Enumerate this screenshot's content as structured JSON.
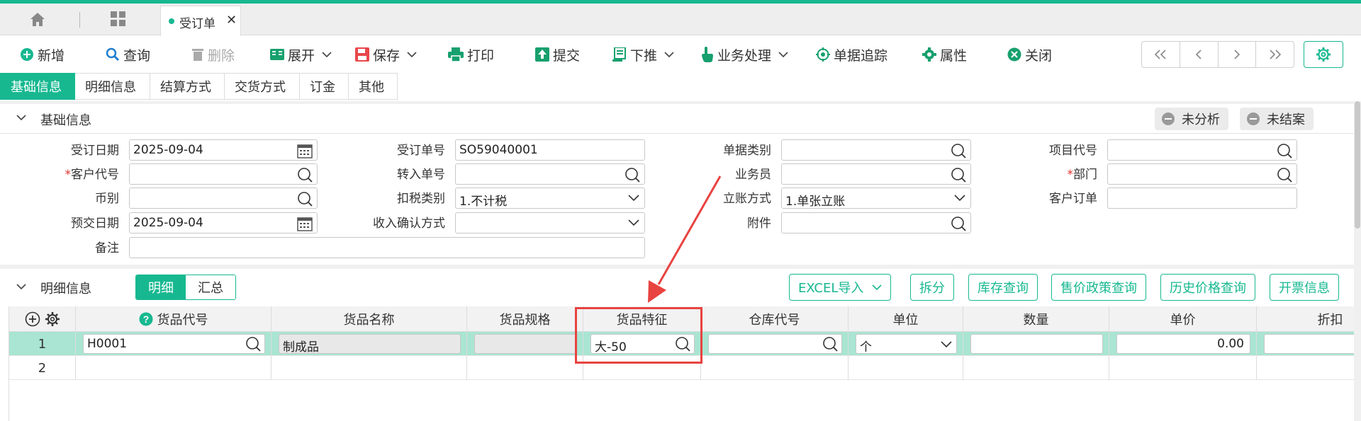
{
  "colors": {
    "accent": "#17b890",
    "annotation": "#e84340",
    "selected_row": "#a9e5d2",
    "required": "#e0322e"
  },
  "tabs": {
    "doc_tab_label": "受订单",
    "close_glyph": "✕"
  },
  "toolbar": {
    "new": "新增",
    "query": "查询",
    "delete": "删除",
    "expand": "展开",
    "save": "保存",
    "print": "打印",
    "submit": "提交",
    "push_down": "下推",
    "business": "业务处理",
    "trace": "单据追踪",
    "properties": "属性",
    "close": "关闭"
  },
  "section_tabs": [
    "基础信息",
    "明细信息",
    "结算方式",
    "交货方式",
    "订金",
    "其他"
  ],
  "basic": {
    "title": "基础信息",
    "status_unanalyzed": "未分析",
    "status_unsettled": "未结案",
    "fields": {
      "order_date": {
        "label": "受订日期",
        "value": "2025-09-04"
      },
      "customer_code": {
        "label": "客户代号",
        "value": ""
      },
      "currency": {
        "label": "币别",
        "value": ""
      },
      "delivery_date": {
        "label": "预交日期",
        "value": "2025-09-04"
      },
      "remark": {
        "label": "备注",
        "value": ""
      },
      "order_no": {
        "label": "受订单号",
        "value": "SO59040001"
      },
      "transfer_no": {
        "label": "转入单号",
        "value": ""
      },
      "tax_type": {
        "label": "扣税类别",
        "value": "1.不计税"
      },
      "revenue_method": {
        "label": "收入确认方式",
        "value": ""
      },
      "doc_type": {
        "label": "单据类别",
        "value": ""
      },
      "salesperson": {
        "label": "业务员",
        "value": ""
      },
      "account_method": {
        "label": "立账方式",
        "value": "1.单张立账"
      },
      "attachment": {
        "label": "附件",
        "value": ""
      },
      "project_code": {
        "label": "项目代号",
        "value": ""
      },
      "department": {
        "label": "部门",
        "value": ""
      },
      "customer_order": {
        "label": "客户订单",
        "value": ""
      }
    },
    "required_mark": "*"
  },
  "detail": {
    "title": "明细信息",
    "seg_detail": "明细",
    "seg_summary": "汇总",
    "buttons": {
      "excel_import": "EXCEL导入",
      "split": "拆分",
      "stock_query": "库存查询",
      "policy_query": "售价政策查询",
      "history_price": "历史价格查询",
      "invoice_info": "开票信息"
    },
    "columns": [
      "货品代号",
      "货品名称",
      "货品规格",
      "货品特征",
      "仓库代号",
      "单位",
      "数量",
      "单价",
      "折扣"
    ],
    "rows": [
      {
        "no": "1",
        "item_code": "H0001",
        "item_name": "制成品",
        "spec": "",
        "feature": "大-50",
        "warehouse": "",
        "unit": "个",
        "qty": "",
        "price": "0.00",
        "discount": ""
      },
      {
        "no": "2",
        "item_code": "",
        "item_name": "",
        "spec": "",
        "feature": "",
        "warehouse": "",
        "unit": "",
        "qty": "",
        "price": "",
        "discount": ""
      }
    ]
  }
}
